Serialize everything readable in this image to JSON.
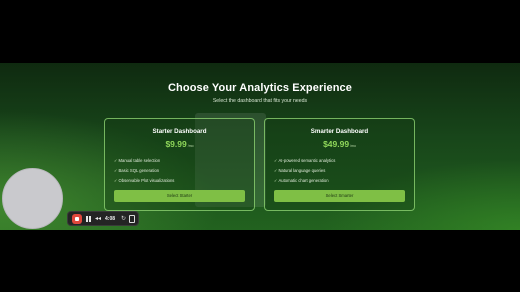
{
  "page": {
    "title": "Choose Your Analytics Experience",
    "subtitle": "Select the dashboard that fits your needs"
  },
  "plans": [
    {
      "name": "Starter Dashboard",
      "price": "$9.99",
      "period": "/mo",
      "features": [
        "Manual table selection",
        "Basic SQL generation",
        "Observable Plot visualizations"
      ],
      "cta": "Select Starter"
    },
    {
      "name": "Smarter Dashboard",
      "price": "$49.99",
      "period": "/mo",
      "features": [
        "AI-powered semantic analytics",
        "Natural language queries",
        "Automatic chart generation"
      ],
      "cta": "Select Smarter"
    }
  ],
  "recorder": {
    "time": "4:08"
  },
  "colors": {
    "accent": "#7fbf45",
    "price": "#8fd65a",
    "record": "#e0483c"
  },
  "icons": {
    "check": "✓",
    "stop": "stop-icon",
    "pause": "pause-icon",
    "rewind": "rewind-icon",
    "restart": "restart-icon",
    "trash": "trash-icon"
  }
}
